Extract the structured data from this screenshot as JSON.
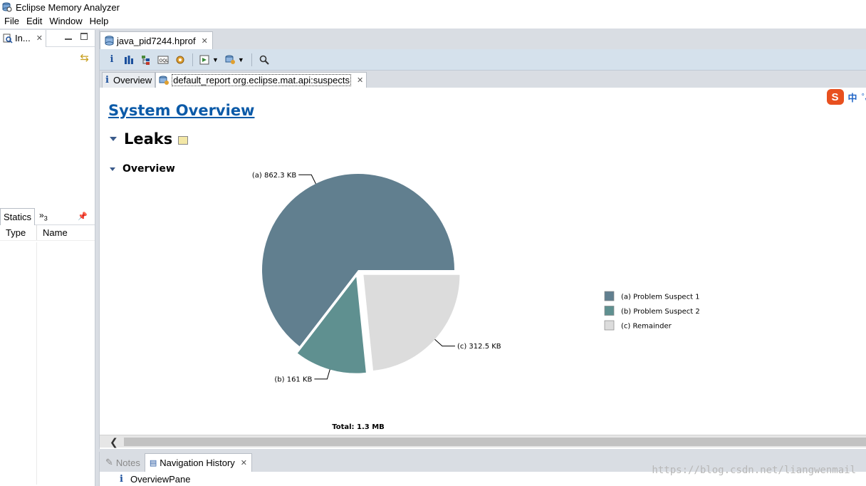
{
  "window": {
    "title": "Eclipse Memory Analyzer"
  },
  "menu": [
    "File",
    "Edit",
    "Window",
    "Help"
  ],
  "left_top": {
    "tab_label": "In..."
  },
  "left_bottom": {
    "tab_label": "Statics",
    "overflow_label": "»",
    "overflow_count": "3",
    "columns": [
      "Type",
      "Name"
    ]
  },
  "editor": {
    "tab_label": "java_pid7244.hprof",
    "inner_tabs": [
      "Overview",
      "default_report  org.eclipse.mat.api:suspects"
    ]
  },
  "content": {
    "page_heading": "System Overview",
    "section_heading": "Leaks",
    "subsection_heading": "Overview"
  },
  "chart_data": {
    "type": "pie",
    "total_label": "Total: 1.3 MB",
    "slices": [
      {
        "key": "a",
        "label": "(a)  862.3 KB",
        "legend": "(a)  Problem Suspect 1",
        "value": 862.3,
        "color": "#617f8f"
      },
      {
        "key": "b",
        "label": "(b)  161 KB",
        "legend": "(b)  Problem Suspect 2",
        "value": 161,
        "color": "#5f9090"
      },
      {
        "key": "c",
        "label": "(c)  312.5 KB",
        "legend": "(c)  Remainder",
        "value": 312.5,
        "color": "#dcdcdc"
      }
    ]
  },
  "ime": {
    "lang": "中",
    "mode": "°,"
  },
  "bottom": {
    "tabs": [
      "Notes",
      "Navigation History"
    ],
    "row_label": "OverviewPane"
  },
  "watermark": "https://blog.csdn.net/liangwenmail"
}
